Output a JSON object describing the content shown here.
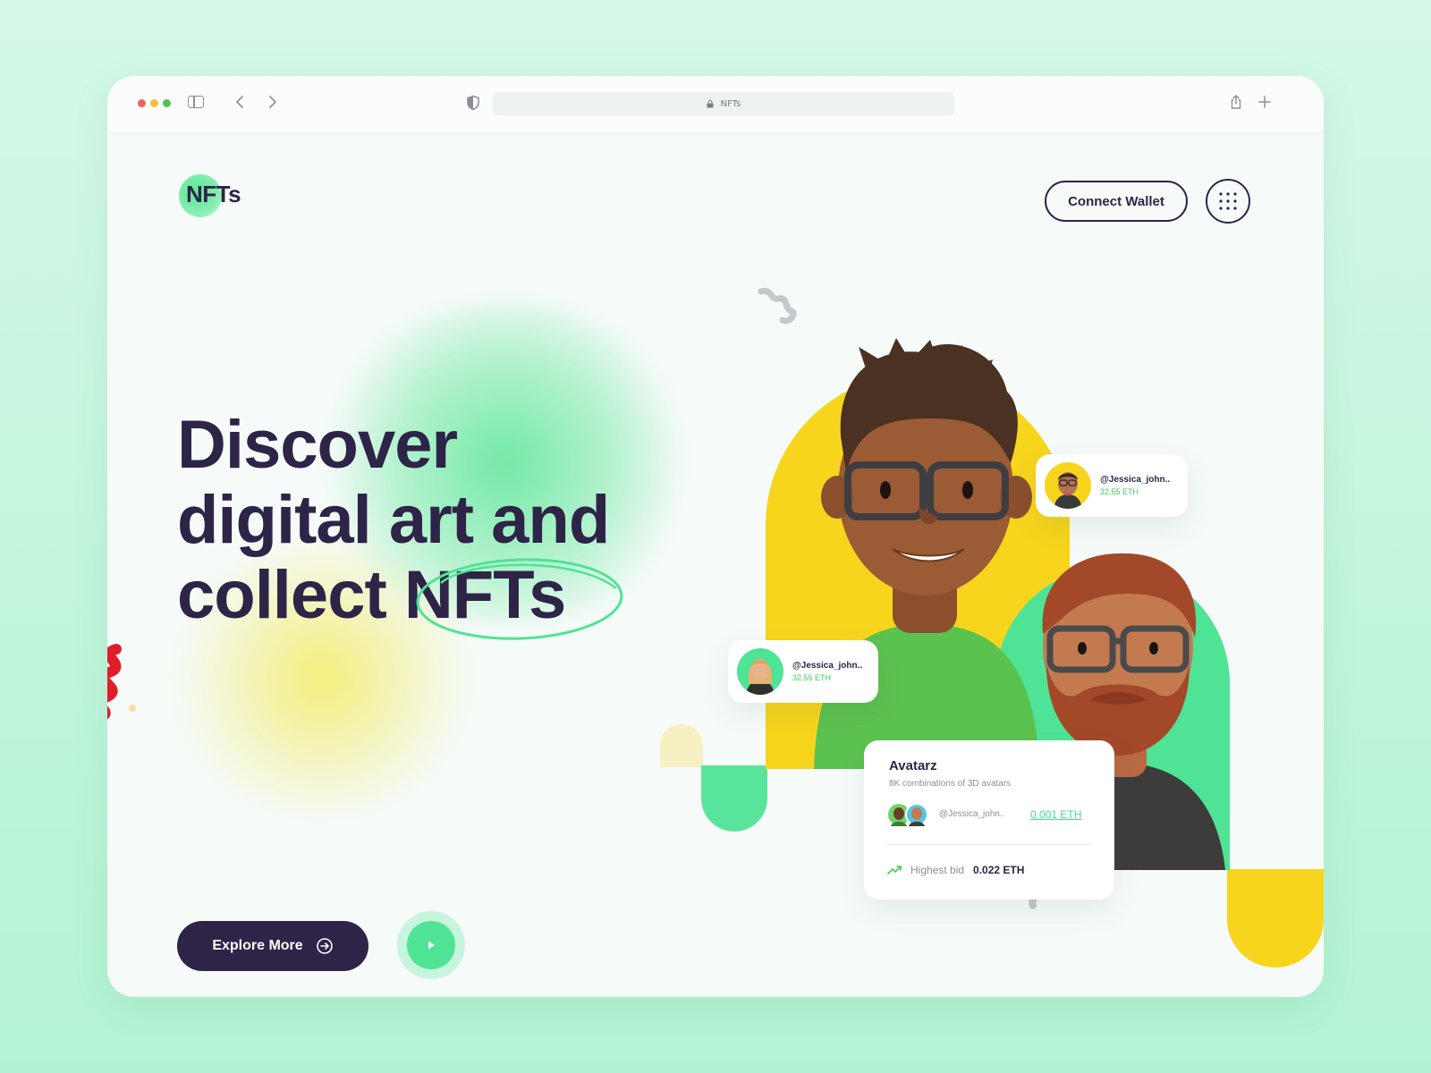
{
  "browser": {
    "url_text": "NFTs"
  },
  "header": {
    "logo_text": "NFTs",
    "connect_wallet_label": "Connect Wallet"
  },
  "hero": {
    "line1": "Discover",
    "line2": "digital art and",
    "line3_prefix": "collect ",
    "line3_highlight": "NFTs",
    "explore_label": "Explore More"
  },
  "cards": {
    "top_right": {
      "handle": "@Jessica_john..",
      "price": "32.55 ETH"
    },
    "left": {
      "handle": "@Jessica_john..",
      "price": "32.55 ETH"
    },
    "avatarz": {
      "title": "Avatarz",
      "subtitle": "8K combinations of 3D avatars",
      "owner": "@Jessica_john..",
      "price": "0.001 ETH",
      "bid_label": "Highest bid",
      "bid_value": "0.022 ETH"
    }
  },
  "icons": [
    "sidebar-icon",
    "chevron-left-icon",
    "chevron-right-icon",
    "shield-icon",
    "lock-icon",
    "share-icon",
    "plus-icon",
    "grid-menu-icon",
    "arrow-circle-right-icon",
    "play-icon",
    "trending-up-icon"
  ],
  "colors": {
    "background": "#c2f5dc",
    "ink": "#2d2448",
    "accent_green": "#4fe396",
    "accent_yellow": "#f7d51d",
    "price_green": "#3ccf62"
  }
}
